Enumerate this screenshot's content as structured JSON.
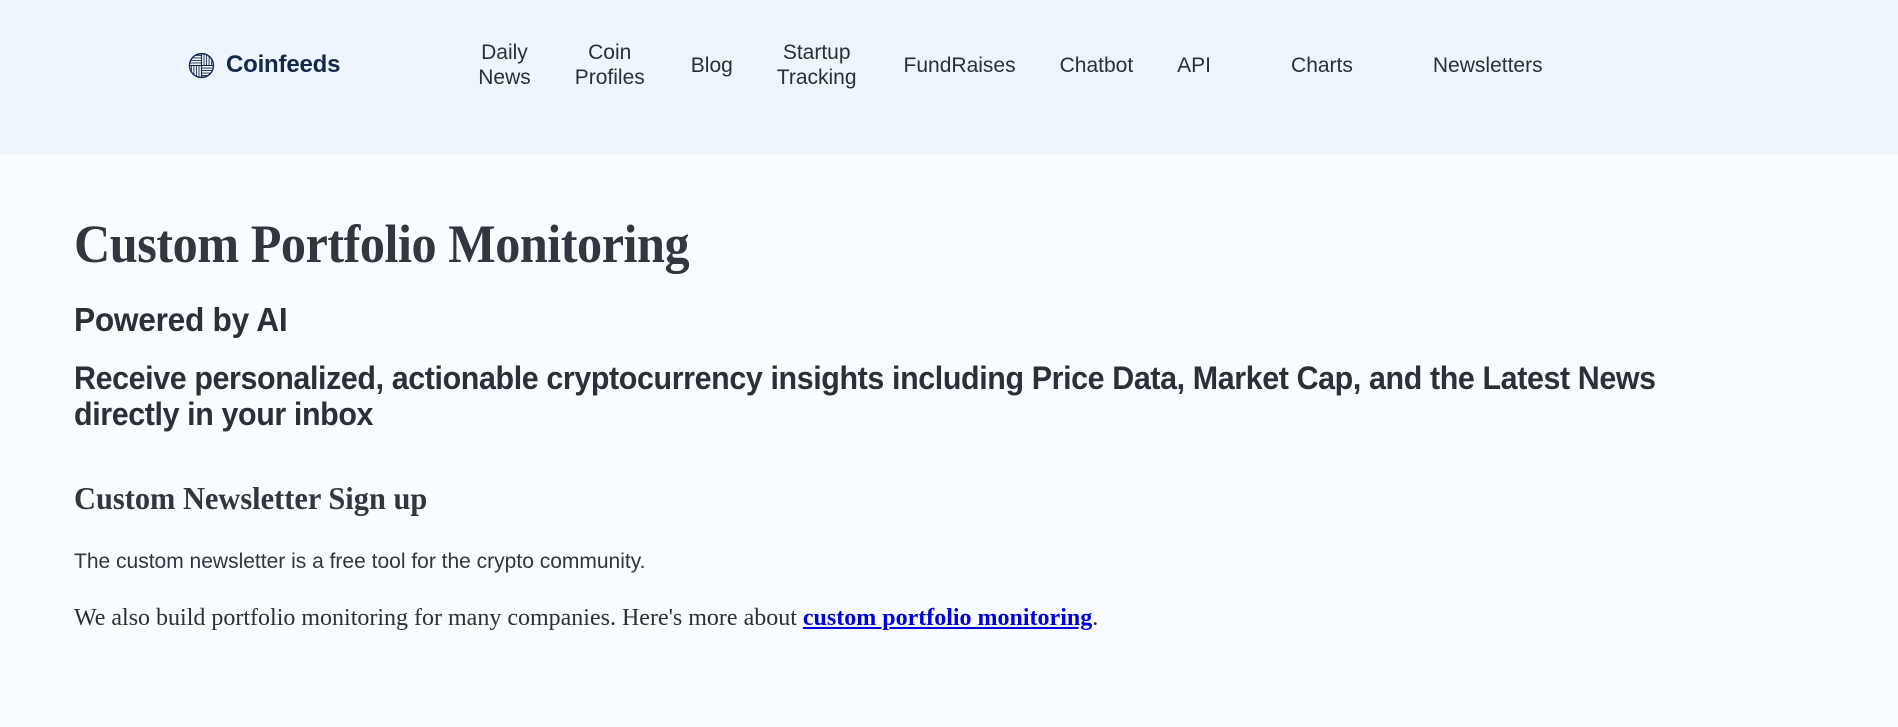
{
  "header": {
    "brand": {
      "name": "Coinfeeds",
      "logo_icon": "coinfeeds-circle-hatch-logo"
    },
    "nav": [
      {
        "label": "Daily\nNews"
      },
      {
        "label": "Coin\nProfiles"
      },
      {
        "label": "Blog"
      },
      {
        "label": "Startup\nTracking"
      },
      {
        "label": "FundRaises"
      },
      {
        "label": "Chatbot"
      },
      {
        "label": "API"
      },
      {
        "label": "Charts"
      },
      {
        "label": "Newsletters"
      }
    ],
    "background_color": "#eff5fd"
  },
  "main": {
    "page_title": "Custom Portfolio Monitoring",
    "subtitle": "Powered by AI",
    "lede": "Receive personalized, actionable cryptocurrency insights including Price Data, Market Cap, and the Latest News directly in your inbox",
    "section_title": "Custom Newsletter Sign up",
    "paragraph_free_tool": "The custom newsletter is a free tool for the crypto community.",
    "paragraph_monitoring": {
      "before": "We also build portfolio monitoring for many companies. Here's more about ",
      "link_text": "custom portfolio monitoring",
      "after": "."
    },
    "background_color": "#f8fbff",
    "link_color": "#0000dd"
  }
}
